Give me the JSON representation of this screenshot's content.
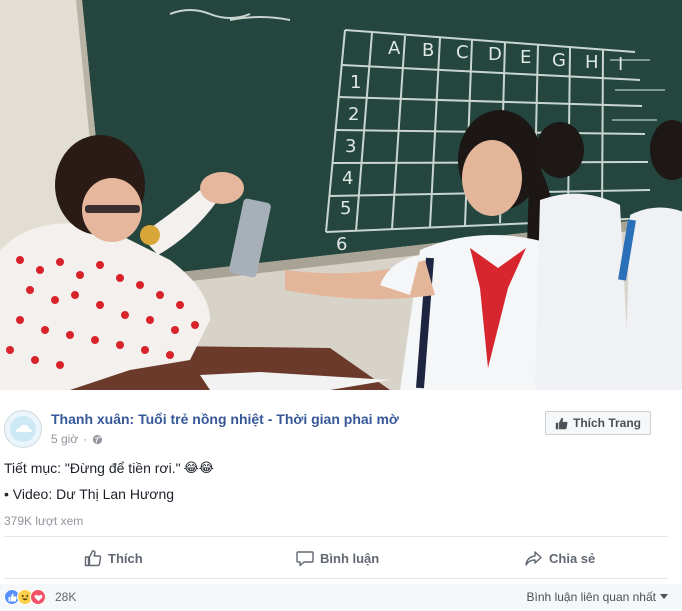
{
  "post": {
    "page_name": "Thanh xuân: Tuổi trẻ nồng nhiệt - Thời gian phai mờ",
    "time": "5 giờ",
    "privacy_icon": "globe-icon",
    "like_page_label": "Thích Trang",
    "caption": "Tiết mục: \"Đừng để tiền rơi.\"",
    "caption_emoji": "😂😂",
    "credit": "• Video: Dư Thị Lan Hương",
    "views": "379K lượt xem"
  },
  "blackboard": {
    "columns": [
      "A",
      "B",
      "C",
      "D",
      "E",
      "G",
      "H",
      "I"
    ],
    "rows": [
      "1",
      "2",
      "3",
      "4",
      "5",
      "6"
    ]
  },
  "actions": {
    "like": "Thích",
    "comment": "Bình luận",
    "share": "Chia sẻ"
  },
  "reactions": {
    "types": [
      "like",
      "haha",
      "love"
    ],
    "count": "28K",
    "sort_label": "Bình luận liên quan nhất"
  },
  "colors": {
    "link": "#365899",
    "muted": "#90949c",
    "like_blue": "#5890ff",
    "love_red": "#f25268",
    "haha_yellow": "#fcd24a"
  }
}
